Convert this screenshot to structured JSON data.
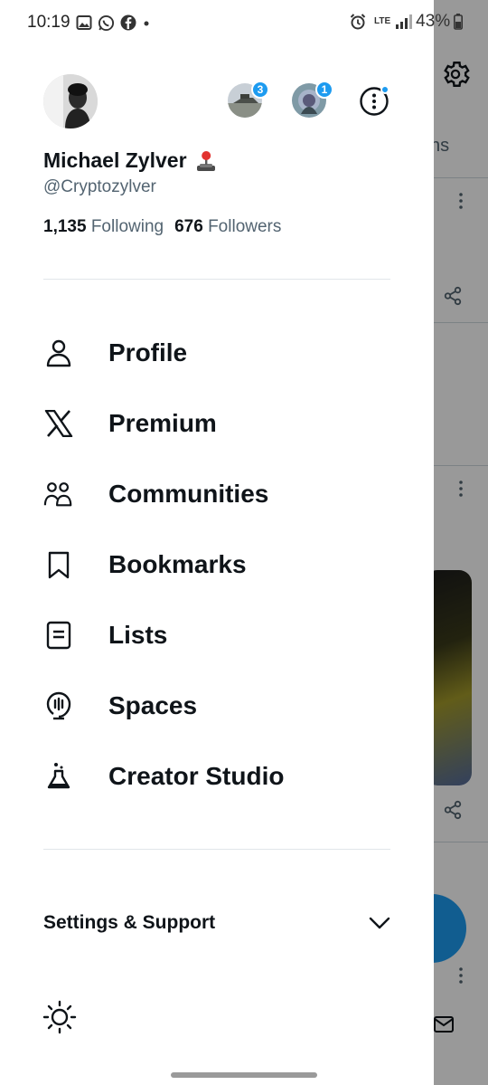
{
  "status_bar": {
    "time": "10:19",
    "battery": "43%",
    "network": "LTE"
  },
  "background": {
    "tab_fragment": "ns"
  },
  "profile": {
    "display_name": "Michael Zylver",
    "handle": "@Cryptozylver",
    "following_count": "1,135",
    "following_label": "Following",
    "followers_count": "676",
    "followers_label": "Followers"
  },
  "accounts": [
    {
      "badge": "3"
    },
    {
      "badge": "1"
    }
  ],
  "menu": [
    {
      "label": "Profile",
      "icon": "person-icon"
    },
    {
      "label": "Premium",
      "icon": "x-logo-icon"
    },
    {
      "label": "Communities",
      "icon": "communities-icon"
    },
    {
      "label": "Bookmarks",
      "icon": "bookmark-icon"
    },
    {
      "label": "Lists",
      "icon": "list-icon"
    },
    {
      "label": "Spaces",
      "icon": "spaces-icon"
    },
    {
      "label": "Creator Studio",
      "icon": "flask-icon"
    }
  ],
  "settings": {
    "label": "Settings & Support"
  },
  "colors": {
    "accent": "#1d9bf0",
    "text": "#0f1419",
    "muted": "#536471"
  }
}
